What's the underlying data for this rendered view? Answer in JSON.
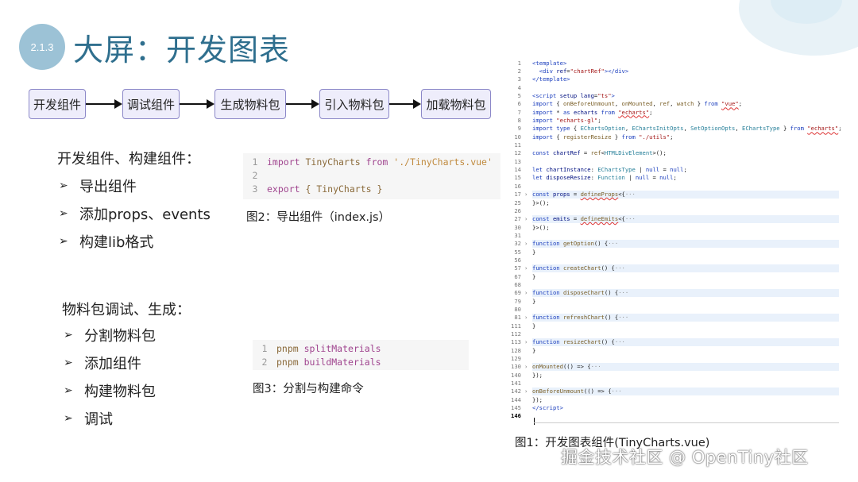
{
  "slide": {
    "badge": "2.1.3",
    "title": "大屏：开发图表"
  },
  "flow": [
    "开发组件",
    "调试组件",
    "生成物料包",
    "引入物料包",
    "加载物料包"
  ],
  "section1": {
    "title": "开发组件、构建组件：",
    "items": [
      "导出组件",
      "添加props、events",
      "构建lib格式"
    ]
  },
  "section2": {
    "title": "物料包调试、生成：",
    "items": [
      "分割物料包",
      "添加组件",
      "构建物料包",
      "调试"
    ]
  },
  "code1": {
    "lines": [
      {
        "n": "1",
        "a": "import",
        "b": " TinyCharts ",
        "c": "from",
        "d": " './TinyCharts.vue'"
      },
      {
        "n": "2",
        "a": "",
        "b": "",
        "c": "",
        "d": ""
      },
      {
        "n": "3",
        "a": "export",
        "b": " { TinyCharts }",
        "c": "",
        "d": ""
      }
    ],
    "caption": "图2：导出组件（index.js）"
  },
  "code2": {
    "lines": [
      {
        "n": "1",
        "a": "pnpm",
        "b": " splitMaterials"
      },
      {
        "n": "2",
        "a": "pnpm",
        "b": " buildMaterials"
      }
    ],
    "caption": "图3：分割与构建命令"
  },
  "editor": {
    "caption": "图1：开发图表组件(TinyCharts.vue)"
  },
  "watermark": "掘金技术社区 @ OpenTiny社区",
  "colors": {
    "accent": "#2f6f8e",
    "flow_border": "#8c88c8",
    "flow_fill": "#eeedfb",
    "badge": "#9cc2d6"
  }
}
